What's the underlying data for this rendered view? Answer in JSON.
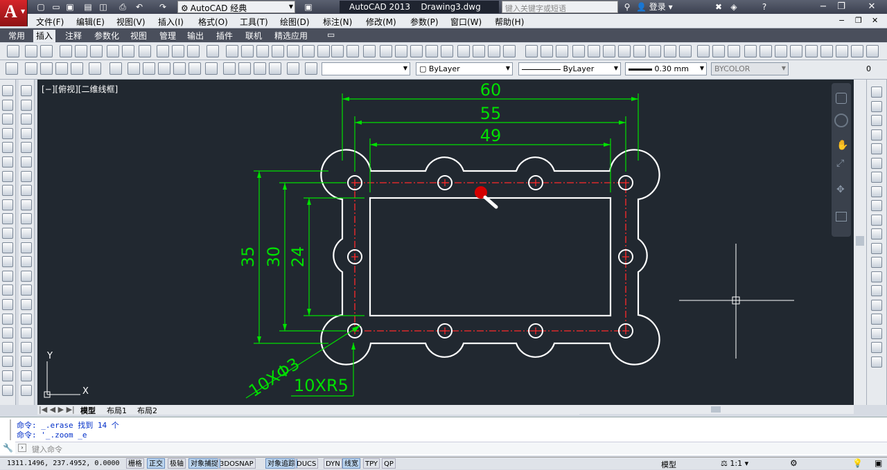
{
  "title_bar": {
    "logo_letter": "A",
    "workspace": "AutoCAD 经典",
    "app_name": "AutoCAD 2013",
    "file_name": "Drawing3.dwg",
    "search_placeholder": "键入关键字或短语",
    "login": "登录",
    "help": "?"
  },
  "menu": [
    "文件(F)",
    "编辑(E)",
    "视图(V)",
    "插入(I)",
    "格式(O)",
    "工具(T)",
    "绘图(D)",
    "标注(N)",
    "修改(M)",
    "参数(P)",
    "窗口(W)",
    "帮助(H)"
  ],
  "ribbon_tabs": [
    "常用",
    "插入",
    "注释",
    "参数化",
    "视图",
    "管理",
    "输出",
    "插件",
    "联机",
    "精选应用"
  ],
  "active_tab": "插入",
  "properties": {
    "color": "ByLayer",
    "linetype": "ByLayer",
    "lineweight": "0.30 mm",
    "plotstyle": "BYCOLOR",
    "layer_value": "0"
  },
  "viewport_label": "[−][俯视][二维线框]",
  "dimensions": {
    "top_60": "60",
    "top_55": "55",
    "top_49": "49",
    "left_35": "35",
    "left_30": "30",
    "left_24": "24",
    "holes": "10XΦ3",
    "radii": "10XR5"
  },
  "ucs": {
    "x": "X",
    "y": "Y"
  },
  "layout_tabs": [
    "模型",
    "布局1",
    "布局2"
  ],
  "command_history": [
    "命令: _.erase 找到 14 个",
    "命令: '_.zoom _e"
  ],
  "command_placeholder": "键入命令",
  "status": {
    "coords": "1311.1496, 237.4952, 0.0000",
    "toggles": [
      {
        "label": "栅格",
        "on": false
      },
      {
        "label": "正交",
        "on": true
      },
      {
        "label": "极轴",
        "on": false
      },
      {
        "label": "对象捕捉",
        "on": true
      },
      {
        "label": "3DOSNAP",
        "on": false
      },
      {
        "label": "对象追踪",
        "on": true
      },
      {
        "label": "DUCS",
        "on": false
      },
      {
        "label": "DYN",
        "on": false
      },
      {
        "label": "线宽",
        "on": true
      },
      {
        "label": "TPY",
        "on": false
      },
      {
        "label": "QP",
        "on": false
      }
    ],
    "model_label": "模型",
    "scale": "1:1"
  },
  "colors": {
    "background": "#212830",
    "dimension": "#00ff00",
    "centerline": "#ff0000",
    "geometry": "#ffffff"
  }
}
